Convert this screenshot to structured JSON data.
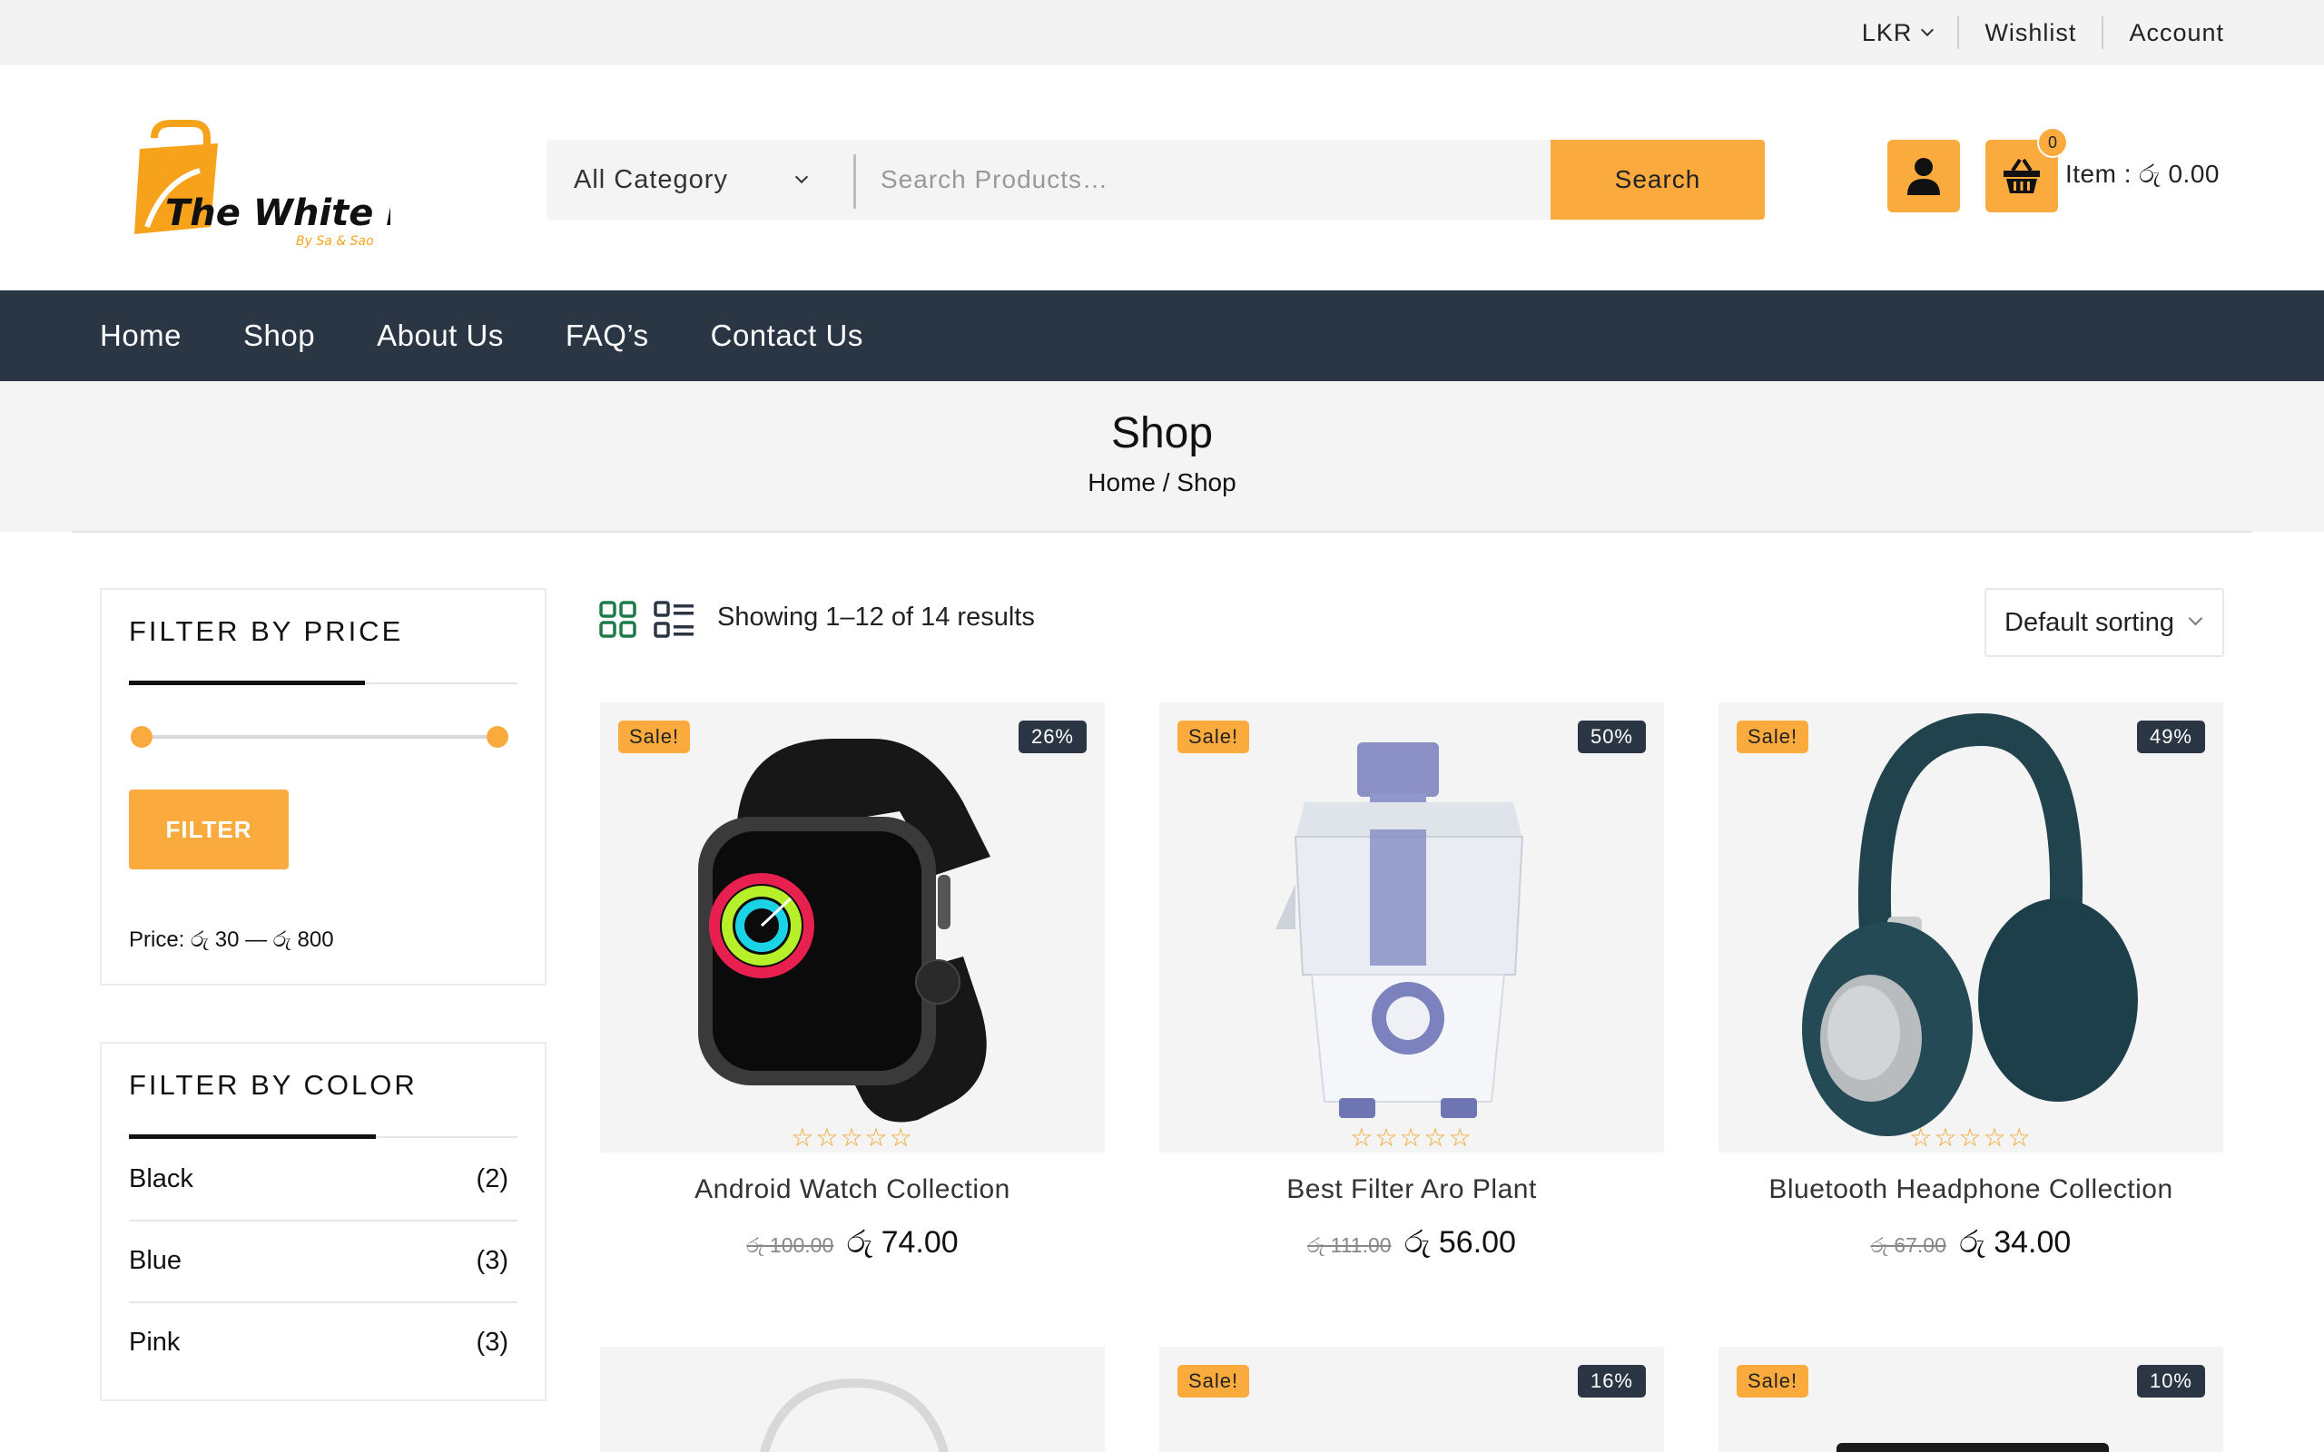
{
  "topbar": {
    "currency": "LKR",
    "wishlist": "Wishlist",
    "account": "Account"
  },
  "header": {
    "logo_text": "The White Market",
    "logo_tagline": "By Sa & Sao",
    "category_select": "All Category",
    "search_placeholder": "Search Products…",
    "search_button": "Search",
    "cart_count": "0",
    "cart_total": "Item : රු 0.00"
  },
  "nav": {
    "items": [
      "Home",
      "Shop",
      "About Us",
      "FAQ’s",
      "Contact Us"
    ]
  },
  "page": {
    "title": "Shop",
    "breadcrumb": "Home / Shop"
  },
  "sidebar": {
    "price_filter": {
      "title": "FILTER BY PRICE",
      "button": "FILTER",
      "price_label": "Price: රු 30 — රු 800",
      "range_min": 30,
      "range_max": 800
    },
    "color_filter": {
      "title": "FILTER BY COLOR",
      "items": [
        {
          "name": "Black",
          "count": "(2)"
        },
        {
          "name": "Blue",
          "count": "(3)"
        },
        {
          "name": "Pink",
          "count": "(3)"
        }
      ]
    }
  },
  "toolbar": {
    "result_count": "Showing 1–12 of 14 results",
    "sorting": "Default sorting"
  },
  "products": [
    {
      "name": "Android Watch Collection",
      "sale": "Sale!",
      "discount": "26%",
      "old_price": "රු 100.00",
      "price": "රු 74.00",
      "rating": "☆☆☆☆☆",
      "image": "watch-icon"
    },
    {
      "name": "Best Filter Aro Plant",
      "sale": "Sale!",
      "discount": "50%",
      "old_price": "රු 111.00",
      "price": "රු 56.00",
      "rating": "☆☆☆☆☆",
      "image": "juicer-icon"
    },
    {
      "name": "Bluetooth Headphone Collection",
      "sale": "Sale!",
      "discount": "49%",
      "old_price": "රු 67.00",
      "price": "රු 34.00",
      "rating": "☆☆☆☆☆",
      "image": "headphone-icon"
    },
    {
      "name": "",
      "sale": "",
      "discount": "",
      "image": "cable-icon"
    },
    {
      "name": "",
      "sale": "Sale!",
      "discount": "16%",
      "image": "product-icon"
    },
    {
      "name": "",
      "sale": "Sale!",
      "discount": "10%",
      "image": "tablet-icon"
    }
  ],
  "colors": {
    "accent": "#fbab3e",
    "nav_bg": "#2b3645",
    "panel_bg": "#f4f4f4"
  }
}
